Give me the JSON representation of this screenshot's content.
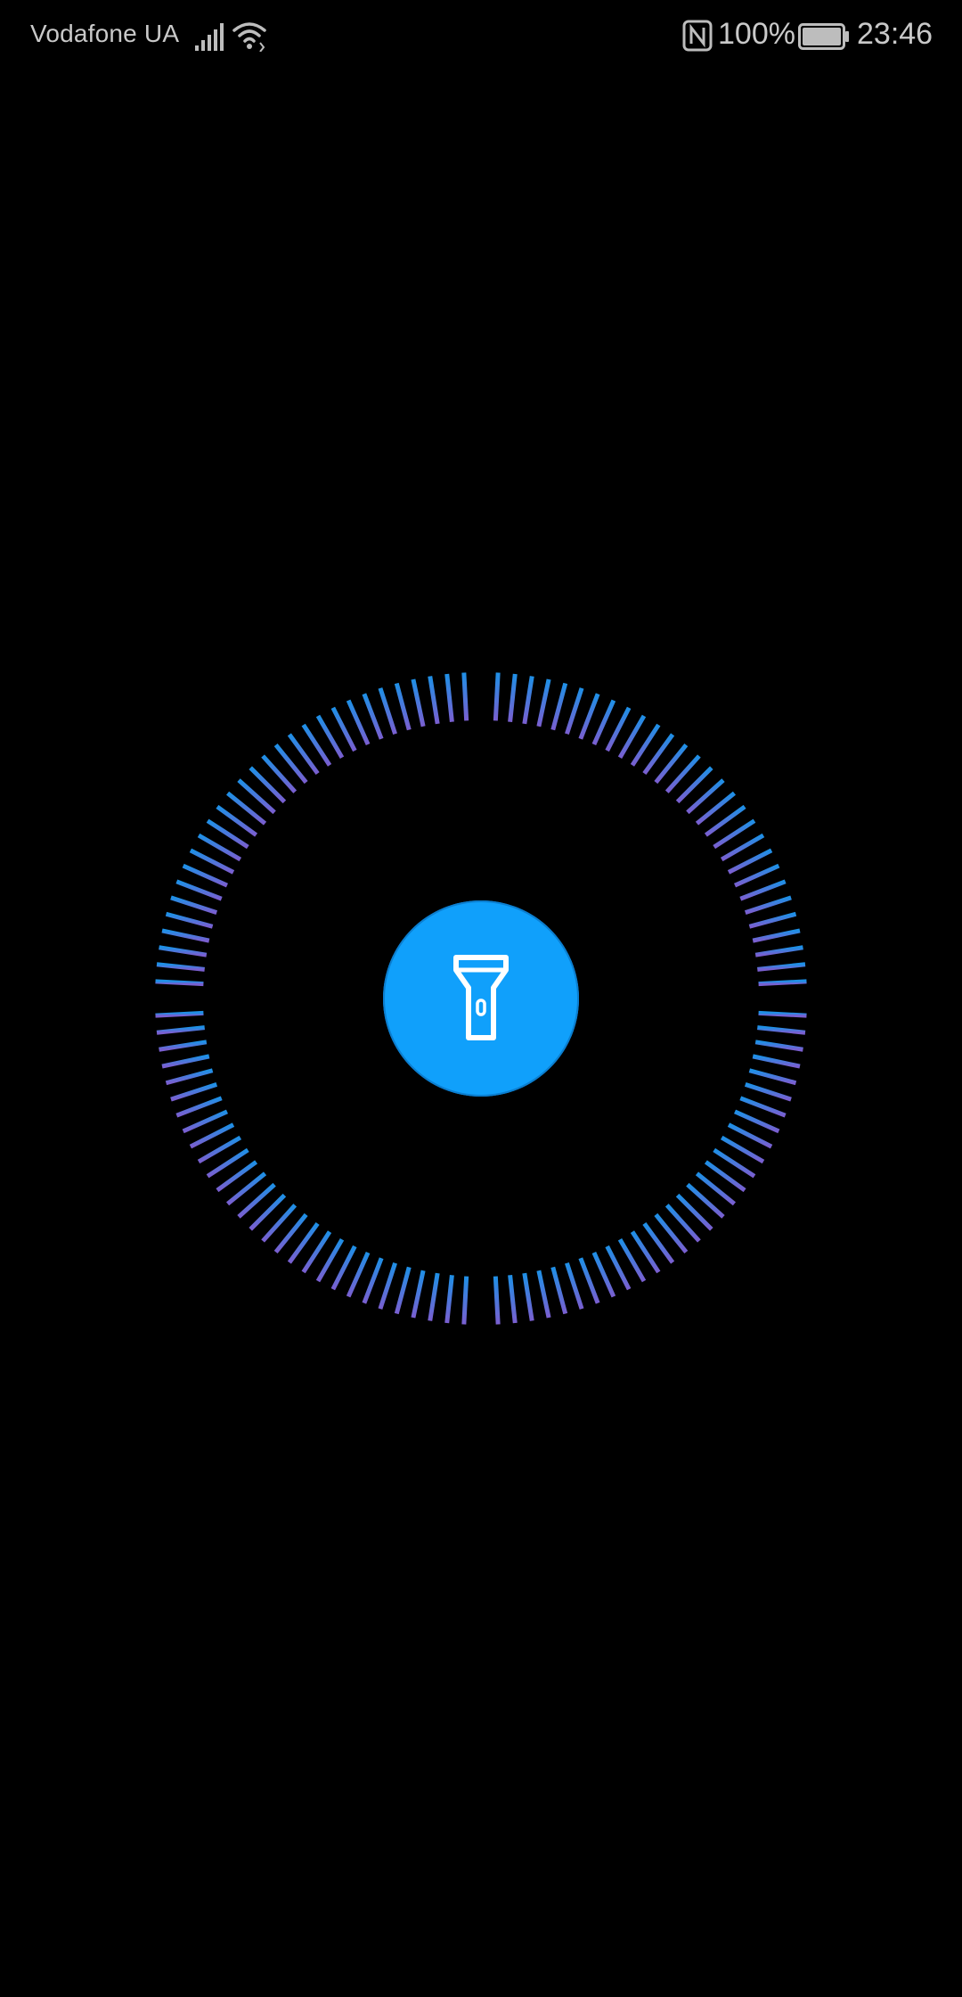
{
  "status_bar": {
    "carrier": "Vodafone UA",
    "signal_icon": "cellular-signal-icon",
    "wifi_icon": "wifi-icon",
    "nfc_icon": "nfc-icon",
    "battery_percent": "100%",
    "battery_level": 1.0,
    "battery_icon": "battery-icon",
    "time": "23:46"
  },
  "flashlight": {
    "state": "off",
    "toggle_icon": "flashlight-icon",
    "ring_tick_count": 120,
    "colors": {
      "button_fill": "#10a0fb",
      "ring_top": "#1e90e6",
      "ring_bottom": "#7a5fd0",
      "background": "#000000"
    }
  }
}
